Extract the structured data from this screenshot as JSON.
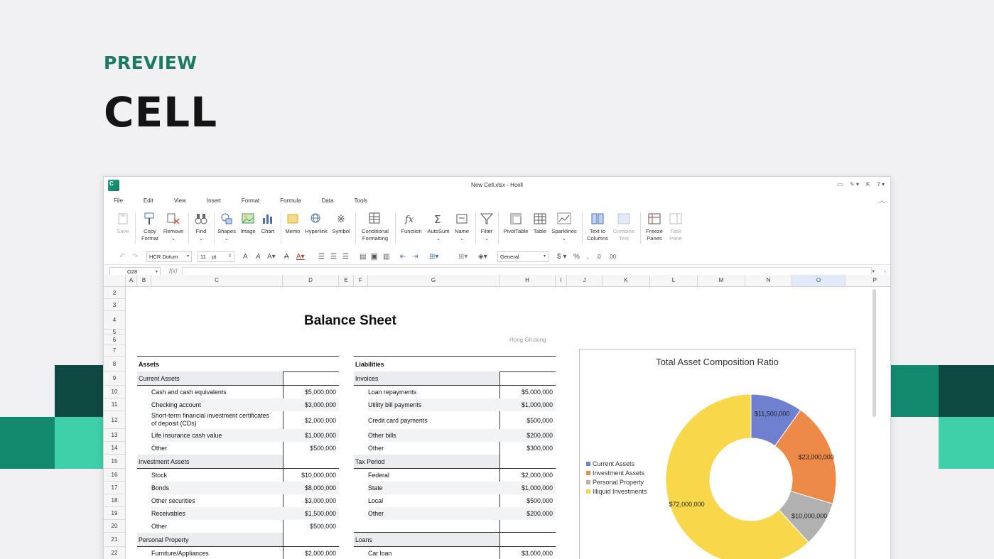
{
  "promo": {
    "eyebrow": "PREVIEW",
    "title": "CELL"
  },
  "window": {
    "title": "New Cell.xlsx - Hcell",
    "logo_letter": "C",
    "user_initial": "K"
  },
  "menu": [
    "File",
    "Edit",
    "View",
    "Insert",
    "Format",
    "Formula",
    "Data",
    "Tools"
  ],
  "ribbon": {
    "save": "Save",
    "copy_format": "Copy",
    "copy_format2": "Format",
    "remove": "Remove",
    "find": "Find",
    "shapes": "Shapes",
    "image": "Image",
    "chart": "Chart",
    "memo": "Memo",
    "hyperlink": "Hyperlink",
    "symbol": "Symbol",
    "cond_fmt": "Conditional",
    "cond_fmt2": "Formatting",
    "function": "Function",
    "autosum": "AutoSum",
    "name": "Name",
    "filter": "Filter",
    "pivot": "PivotTable",
    "table": "Table",
    "sparklines": "Sparklines",
    "text_to_columns": "Text to",
    "text_to_columns2": "Columns",
    "combine_text": "Combine",
    "combine_text2": "Text",
    "freeze": "Freeze",
    "freeze2": "Panes",
    "task_pane": "Task",
    "task_pane2": "Pane"
  },
  "format": {
    "font": "HCR Dotum",
    "size": "11",
    "unit": "pt",
    "number_format": "General"
  },
  "formula": {
    "cell_ref": "O28",
    "fx": "f(x)"
  },
  "columns": [
    "A",
    "B",
    "C",
    "D",
    "E",
    "F",
    "G",
    "H",
    "I",
    "J",
    "K",
    "L",
    "M",
    "N",
    "O",
    "P"
  ],
  "rows": [
    "2",
    "3",
    "4",
    "5",
    "6",
    "7",
    "8",
    "9",
    "10",
    "11",
    "12",
    "13",
    "14",
    "15",
    "16",
    "17",
    "18",
    "19",
    "20",
    "21",
    "22"
  ],
  "sheet": {
    "title": "Balance Sheet",
    "author": "Hong Gil-dong",
    "assets_header": "Assets",
    "liabilities_header": "Liabilities",
    "assets": {
      "current": {
        "label": "Current Assets",
        "items": [
          [
            "Cash and cash equivalents",
            "$5,000,000"
          ],
          [
            "Checking account",
            "$3,000,000"
          ],
          [
            "Short-term financial investment certificates",
            "of deposit (CDs)",
            "$2,000,000"
          ],
          [
            "Life insurance cash value",
            "$1,000,000"
          ],
          [
            "Other",
            "$500,000"
          ]
        ]
      },
      "investment": {
        "label": "Investment Assets",
        "items": [
          [
            "Stock",
            "$10,000,000"
          ],
          [
            "Bonds",
            "$8,000,000"
          ],
          [
            "Other securities",
            "$3,000,000"
          ],
          [
            "Receivables",
            "$1,500,000"
          ],
          [
            "Other",
            "$500,000"
          ]
        ]
      },
      "personal": {
        "label": "Personal Property",
        "items": [
          [
            "Furniture/Appliances",
            "$2,000,000"
          ]
        ]
      }
    },
    "liabilities": {
      "invoices": {
        "label": "Invoices",
        "items": [
          [
            "Loan repayments",
            "$5,000,000"
          ],
          [
            "Utility bill payments",
            "$1,000,000"
          ],
          [
            "Credit card payments",
            "$500,000"
          ],
          [
            "Other bills",
            "$200,000"
          ],
          [
            "Other",
            "$300,000"
          ]
        ]
      },
      "tax": {
        "label": "Tax Period",
        "items": [
          [
            "Federal",
            "$2,000,000"
          ],
          [
            "State",
            "$1,000,000"
          ],
          [
            "Local",
            "$500,000"
          ],
          [
            "Other",
            "$200,000"
          ]
        ]
      },
      "loans": {
        "label": "Loans",
        "items": [
          [
            "Car loan",
            "$3,000,000"
          ]
        ]
      }
    }
  },
  "chart_data": {
    "type": "pie",
    "title": "Total Asset Composition Ratio",
    "donut": true,
    "categories": [
      "Current Assets",
      "Investment Assets",
      "Personal Property",
      "Illiquid Investments"
    ],
    "values": [
      11500000,
      23000000,
      10000000,
      72000000
    ],
    "labels": [
      "$11,500,000",
      "$23,000,000",
      "$10,000,000",
      "$72,000,000"
    ],
    "colors": [
      "#6f80d1",
      "#ee8a47",
      "#b1b1b1",
      "#f8d84a"
    ],
    "legend": "left"
  }
}
